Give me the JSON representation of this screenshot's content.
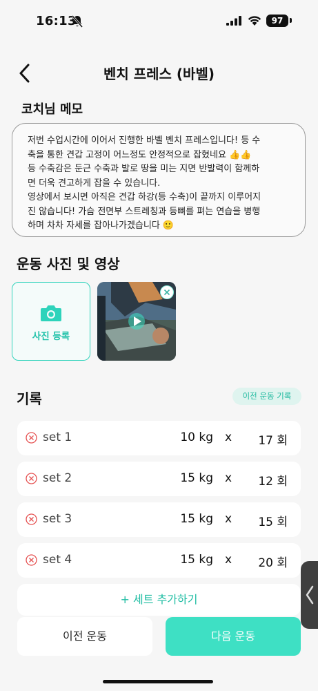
{
  "status_bar": {
    "time": "16:13",
    "battery": "97"
  },
  "header": {
    "title": "벤치 프레스 (바벨)"
  },
  "memo": {
    "title": "코치님 메모",
    "text": "저번 수업시간에 이어서 진행한 바벨 벤치 프레스입니다! 등 수\n축을 통한 견갑 고정이 어느정도 안정적으로 잡혔네요 👍👍\n등 수축감은 둔근 수축과 발로 땅을 미는 지면 반발력이 함께하\n면 더욱 견고하게 잡을 수 있습니다.\n영상에서 보시면 아직은 견갑 하강(등 수축)이 끝까지 이루어지\n진 않습니다! 가슴 전면부 스트레칭과 등뼈를 펴는 연습을 병행\n하며 차차 자세를 잡아나가겠습니다 🙂"
  },
  "media": {
    "title": "운동 사진 및 영상",
    "add_photo_label": "사진 등록"
  },
  "records": {
    "title": "기록",
    "prev_record_label": "이전 운동 기록",
    "sets": [
      {
        "label": "set 1",
        "weight": "10 kg",
        "x": "x",
        "reps": "17 회"
      },
      {
        "label": "set 2",
        "weight": "15 kg",
        "x": "x",
        "reps": "12 회"
      },
      {
        "label": "set 3",
        "weight": "15 kg",
        "x": "x",
        "reps": "15 회"
      },
      {
        "label": "set 4",
        "weight": "15 kg",
        "x": "x",
        "reps": "20 회"
      }
    ],
    "add_set_label": "+ 세트 추가하기"
  },
  "footer": {
    "prev_label": "이전 운동",
    "next_label": "다음 운동"
  },
  "colors": {
    "accent": "#3ee0c4",
    "accent_text": "#1fbda3",
    "remove": "#e55050"
  }
}
